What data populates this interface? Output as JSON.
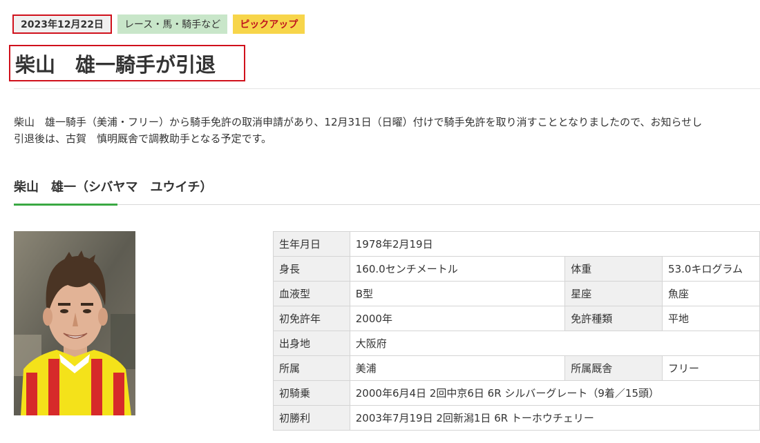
{
  "tags": {
    "date": "2023年12月22日",
    "category": "レース・馬・騎手など",
    "pickup": "ピックアップ"
  },
  "article": {
    "title": "柴山　雄一騎手が引退",
    "paragraph1": "柴山　雄一騎手（美浦・フリー）から騎手免許の取消申請があり、12月31日（日曜）付けで騎手免許を取り消すこととなりましたので、お知らせし",
    "paragraph2": "引退後は、古賀　慎明厩舎で調教助手となる予定です。"
  },
  "profile": {
    "heading": "柴山　雄一（シバヤマ　ユウイチ）",
    "rows": [
      {
        "label": "生年月日",
        "value": "1978年2月19日"
      },
      {
        "label": "身長",
        "value": "160.0センチメートル",
        "label2": "体重",
        "value2": "53.0キログラム"
      },
      {
        "label": "血液型",
        "value": "B型",
        "label2": "星座",
        "value2": "魚座"
      },
      {
        "label": "初免許年",
        "value": "2000年",
        "label2": "免許種類",
        "value2": "平地"
      },
      {
        "label": "出身地",
        "value": "大阪府"
      },
      {
        "label": "所属",
        "value": "美浦",
        "label2": "所属厩舎",
        "value2": "フリー"
      },
      {
        "label": "初騎乗",
        "value": "2000年6月4日 2回中京6日 6R シルバーグレート（9着／15頭）"
      },
      {
        "label": "初勝利",
        "value": "2003年7月19日 2回新潟1日 6R トーホウチェリー"
      }
    ]
  }
}
